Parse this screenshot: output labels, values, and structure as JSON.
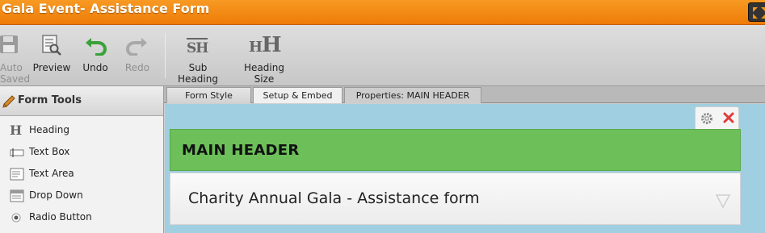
{
  "window": {
    "title": "Gala Event- Assistance Form"
  },
  "toolbar": {
    "auto_saved": {
      "line1": "Auto",
      "line2": "Saved",
      "icon": "floppy-disk-icon"
    },
    "preview": {
      "label": "Preview",
      "icon": "preview-icon"
    },
    "undo": {
      "label": "Undo",
      "icon": "undo-arrow-icon",
      "color": "#3aa13a"
    },
    "redo": {
      "label": "Redo",
      "icon": "redo-arrow-icon"
    },
    "sub_heading": {
      "line1": "Sub",
      "line2": "Heading",
      "glyph": "SH"
    },
    "heading_size": {
      "line1": "Heading",
      "line2": "Size",
      "glyph": "HH"
    }
  },
  "tabs": [
    {
      "label": "Form Style"
    },
    {
      "label": "Setup & Embed"
    },
    {
      "label": "Properties: MAIN HEADER"
    }
  ],
  "sidebar": {
    "title": "Form Tools",
    "items": [
      {
        "label": "Heading",
        "icon": "heading-icon"
      },
      {
        "label": "Text Box",
        "icon": "text-box-icon"
      },
      {
        "label": "Text Area",
        "icon": "text-area-icon"
      },
      {
        "label": "Drop Down",
        "icon": "drop-down-icon"
      },
      {
        "label": "Radio Button",
        "icon": "radio-button-icon"
      }
    ]
  },
  "form": {
    "header_text": "MAIN HEADER",
    "sub_text": "Charity Annual Gala - Assistance form",
    "colors": {
      "header_bg": "#6dbf5a",
      "canvas_bg": "#9fcfe0",
      "accent": "#ee7b07"
    }
  }
}
